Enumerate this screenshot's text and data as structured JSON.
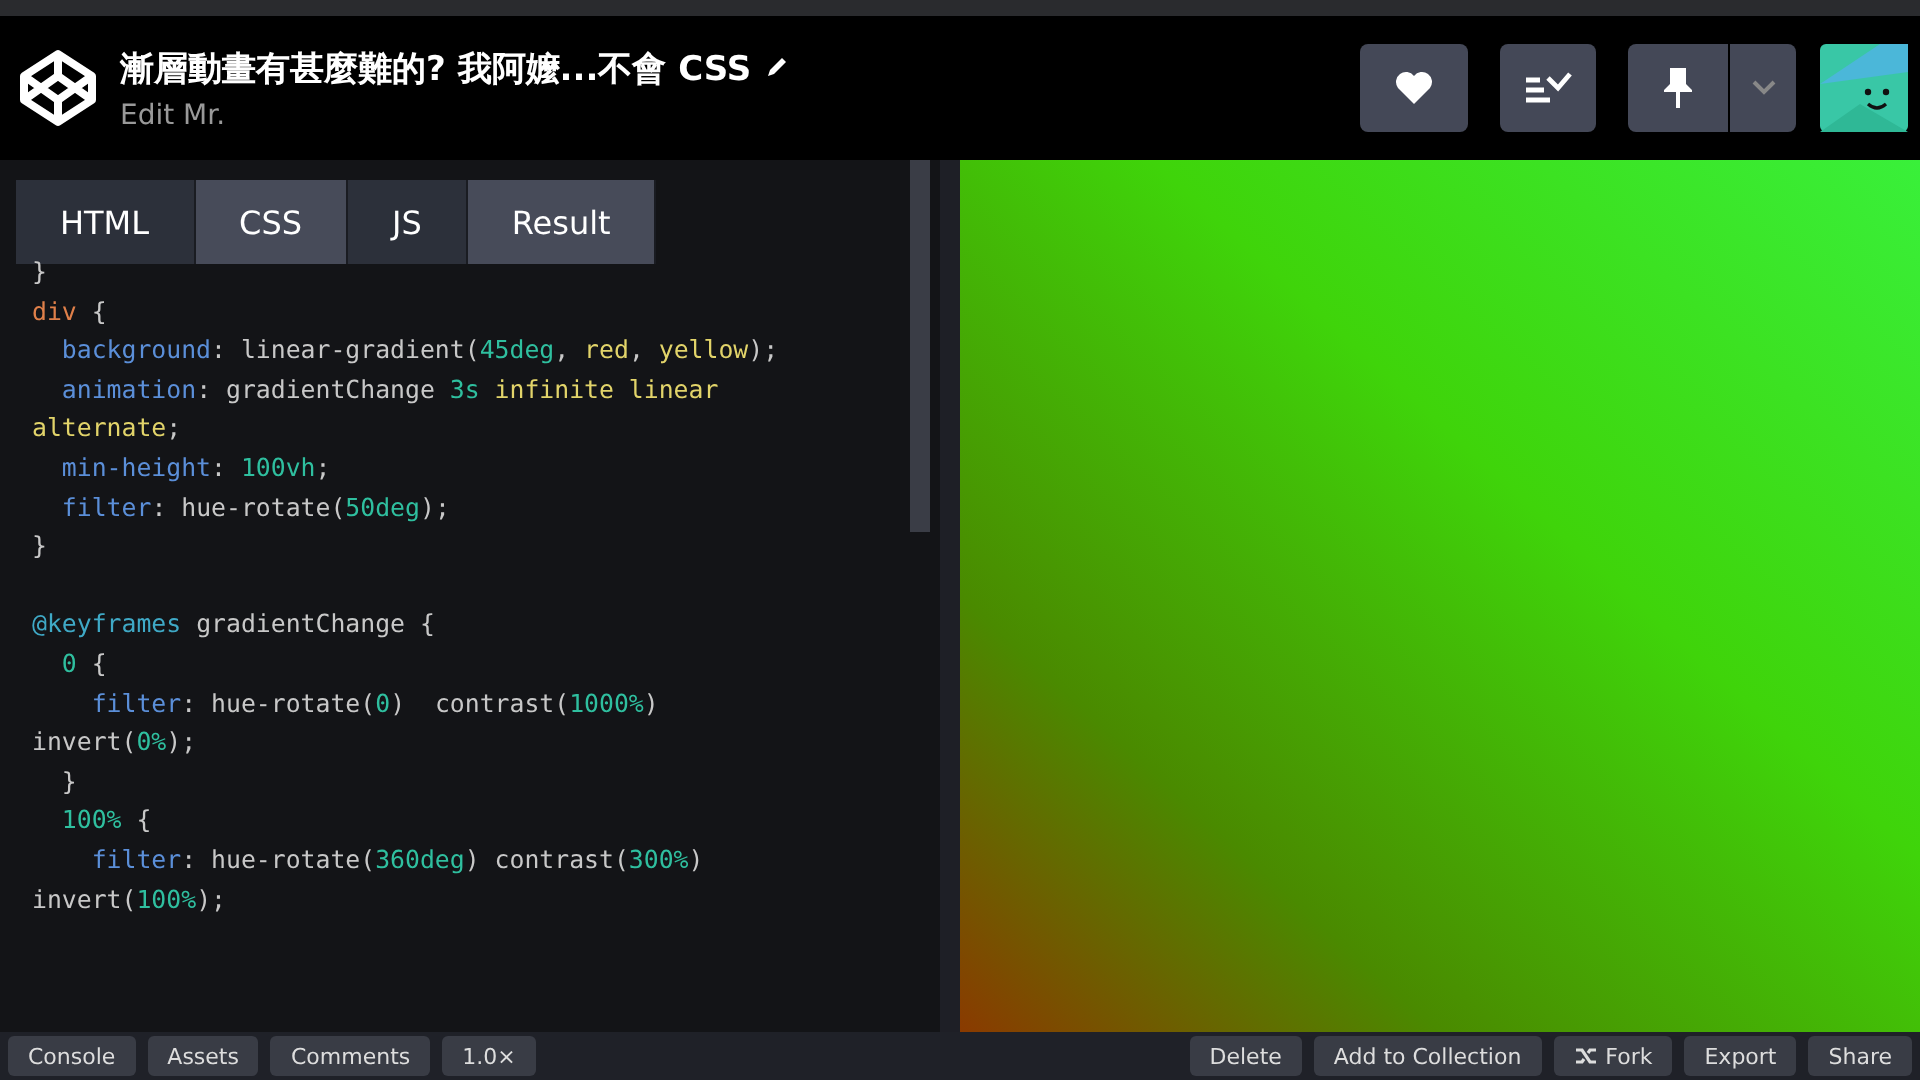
{
  "header": {
    "title": "漸層動畫有甚麼難的? 我阿嬤...不會 CSS",
    "subtitle": "Edit Mr."
  },
  "tabs": [
    {
      "label": "HTML",
      "selected": false
    },
    {
      "label": "CSS",
      "selected": true
    },
    {
      "label": "JS",
      "selected": false
    },
    {
      "label": "Result",
      "selected": true
    }
  ],
  "code_blocks": [
    {
      "lines": [
        {
          "tokens": [
            {
              "kind": "plain",
              "text": "}"
            }
          ]
        },
        {
          "tokens": [
            {
              "kind": "tag",
              "text": "div"
            },
            {
              "kind": "plain",
              "text": " {"
            }
          ]
        },
        {
          "tokens": [
            {
              "kind": "prop",
              "text": "  background"
            },
            {
              "kind": "plain",
              "text": ": linear-gradient("
            },
            {
              "kind": "num",
              "text": "45deg"
            },
            {
              "kind": "plain",
              "text": ", "
            },
            {
              "kind": "kw",
              "text": "red"
            },
            {
              "kind": "plain",
              "text": ", "
            },
            {
              "kind": "kw",
              "text": "yellow"
            },
            {
              "kind": "plain",
              "text": ");"
            }
          ]
        },
        {
          "tokens": [
            {
              "kind": "prop",
              "text": "  animation"
            },
            {
              "kind": "plain",
              "text": ": gradientChange "
            },
            {
              "kind": "num",
              "text": "3s"
            },
            {
              "kind": "kw",
              "text": " infinite linear"
            }
          ]
        },
        {
          "tokens": [
            {
              "kind": "kw",
              "text": "alternate"
            },
            {
              "kind": "plain",
              "text": ";"
            }
          ]
        },
        {
          "tokens": [
            {
              "kind": "prop",
              "text": "  min-height"
            },
            {
              "kind": "plain",
              "text": ": "
            },
            {
              "kind": "num",
              "text": "100vh"
            },
            {
              "kind": "plain",
              "text": ";"
            }
          ]
        },
        {
          "tokens": [
            {
              "kind": "prop",
              "text": "  filter"
            },
            {
              "kind": "plain",
              "text": ": hue-rotate("
            },
            {
              "kind": "num",
              "text": "50deg"
            },
            {
              "kind": "plain",
              "text": ");"
            }
          ]
        },
        {
          "tokens": [
            {
              "kind": "plain",
              "text": "}"
            }
          ]
        }
      ]
    },
    {
      "lines": [
        {
          "tokens": [
            {
              "kind": "at",
              "text": "@keyframes"
            },
            {
              "kind": "plain",
              "text": " gradientChange {"
            }
          ]
        },
        {
          "tokens": [
            {
              "kind": "num",
              "text": "  0"
            },
            {
              "kind": "plain",
              "text": " {"
            }
          ]
        },
        {
          "tokens": [
            {
              "kind": "prop",
              "text": "    filter"
            },
            {
              "kind": "plain",
              "text": ": hue-rotate("
            },
            {
              "kind": "num",
              "text": "0"
            },
            {
              "kind": "plain",
              "text": ")  contrast("
            },
            {
              "kind": "num",
              "text": "1000%"
            },
            {
              "kind": "plain",
              "text": ")"
            }
          ]
        },
        {
          "tokens": [
            {
              "kind": "plain",
              "text": "invert("
            },
            {
              "kind": "num",
              "text": "0%"
            },
            {
              "kind": "plain",
              "text": ");"
            }
          ]
        },
        {
          "tokens": [
            {
              "kind": "plain",
              "text": "  }"
            }
          ]
        },
        {
          "tokens": [
            {
              "kind": "num",
              "text": "  100%"
            },
            {
              "kind": "plain",
              "text": " {"
            }
          ]
        },
        {
          "tokens": [
            {
              "kind": "prop",
              "text": "    filter"
            },
            {
              "kind": "plain",
              "text": ": hue-rotate("
            },
            {
              "kind": "num",
              "text": "360deg"
            },
            {
              "kind": "plain",
              "text": ") contrast("
            },
            {
              "kind": "num",
              "text": "300%"
            },
            {
              "kind": "plain",
              "text": ")"
            }
          ]
        },
        {
          "tokens": [
            {
              "kind": "plain",
              "text": "invert("
            },
            {
              "kind": "num",
              "text": "100%"
            },
            {
              "kind": "plain",
              "text": ");"
            }
          ]
        }
      ]
    }
  ],
  "footer_left": [
    "Console",
    "Assets",
    "Comments",
    "1.0×"
  ],
  "footer_right": [
    {
      "label": "Delete",
      "kind": "text"
    },
    {
      "label": "Add to Collection",
      "kind": "text"
    },
    {
      "label": "Fork",
      "kind": "fork"
    },
    {
      "label": "Export",
      "kind": "text"
    },
    {
      "label": "Share",
      "kind": "text"
    }
  ]
}
